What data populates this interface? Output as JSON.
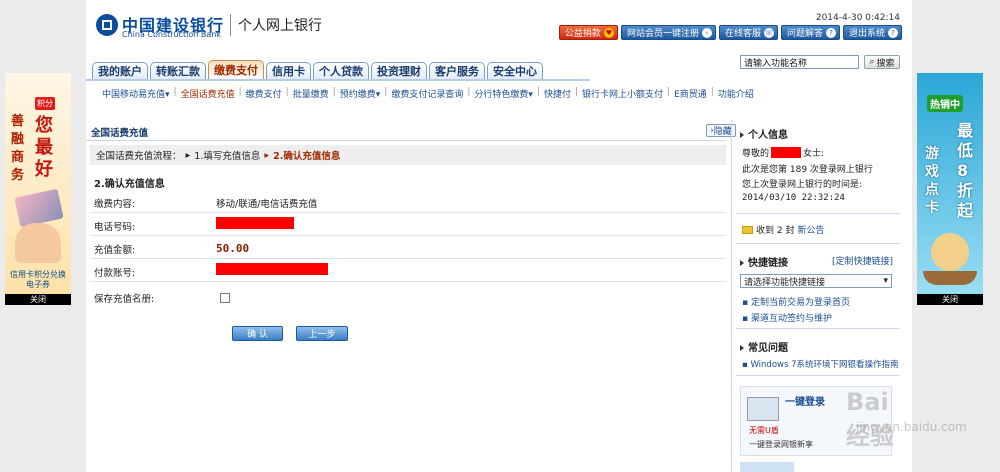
{
  "header": {
    "bank_name_cn": "中国建设银行",
    "bank_name_en": "China Construction Bank",
    "subtitle": "个人网上银行",
    "datetime": "2014-4-30 0:42:14",
    "buttons": [
      "公益捐款",
      "网站会员一键注册",
      "在线客服",
      "问题解答",
      "退出系统"
    ]
  },
  "tabs": [
    "我的账户",
    "转账汇款",
    "缴费支付",
    "信用卡",
    "个人贷款",
    "投资理财",
    "客户服务",
    "安全中心"
  ],
  "active_tab": "缴费支付",
  "search": {
    "value": "请输入功能名称",
    "button": "搜索"
  },
  "subnav": [
    "中国移动易充值▾",
    "全国话费充值",
    "缴费支付",
    "批量缴费",
    "预约缴费▾",
    "缴费支付记录查询",
    "分行特色缴费▾",
    "快捷付",
    "银行卡网上小额支付",
    "E商贸通",
    "功能介绍"
  ],
  "main": {
    "title": "全国话费充值",
    "hide_label": "隐藏",
    "flow_label": "全国话费充值流程：",
    "flow_step1": "1.填写充值信息",
    "flow_step2": "2.确认充值信息",
    "section_title": "2.确认充值信息",
    "fields": {
      "fee_label": "缴费内容:",
      "fee_value": "移动/联通/电信话费充值",
      "phone_label": "电话号码:",
      "amount_label": "充值金额:",
      "amount_value": "50.00",
      "account_label": "付款账号:",
      "save_label": "保存充值名册:"
    },
    "confirm_button": "确 认",
    "back_button": "上一步"
  },
  "sidebar": {
    "personal_info_title": "个人信息",
    "greeting_prefix": "尊敬的",
    "greeting_suffix": "女士:",
    "login_count_line": "此次是您第 189 次登录网上银行",
    "last_login_label": "您上次登录网上银行的时间是:",
    "last_login_time": "2014/03/10 22:32:24",
    "notice_prefix": "收到 2 封",
    "notice_link": "新公告",
    "quick_links_title": "快捷链接",
    "quick_links_custom": "[定制快捷链接]",
    "quick_select": "请选择功能快捷链接",
    "quick_items": [
      "定制当前交易为登录首页",
      "渠道互动签约与维护"
    ],
    "faq_title": "常见问题",
    "faq_items": [
      "Windows 7系统环境下网银看操作指南"
    ],
    "ad_line1": "一键登录",
    "ad_line2": "无需U盾",
    "ad_line3": "一键登录网银新享"
  },
  "banners": {
    "left_close": "关闭",
    "right_close": "关闭",
    "left_text": "善融商务",
    "left_badge": "积分",
    "left_big": "您最好",
    "left_foot": "信用卡积分兑换电子券",
    "right_badge": "热销中",
    "right_big": "最低8折起",
    "right_text": "游戏点卡"
  },
  "watermark": {
    "brand": "Bai 经验",
    "url": "jingyan.baidu.com"
  }
}
